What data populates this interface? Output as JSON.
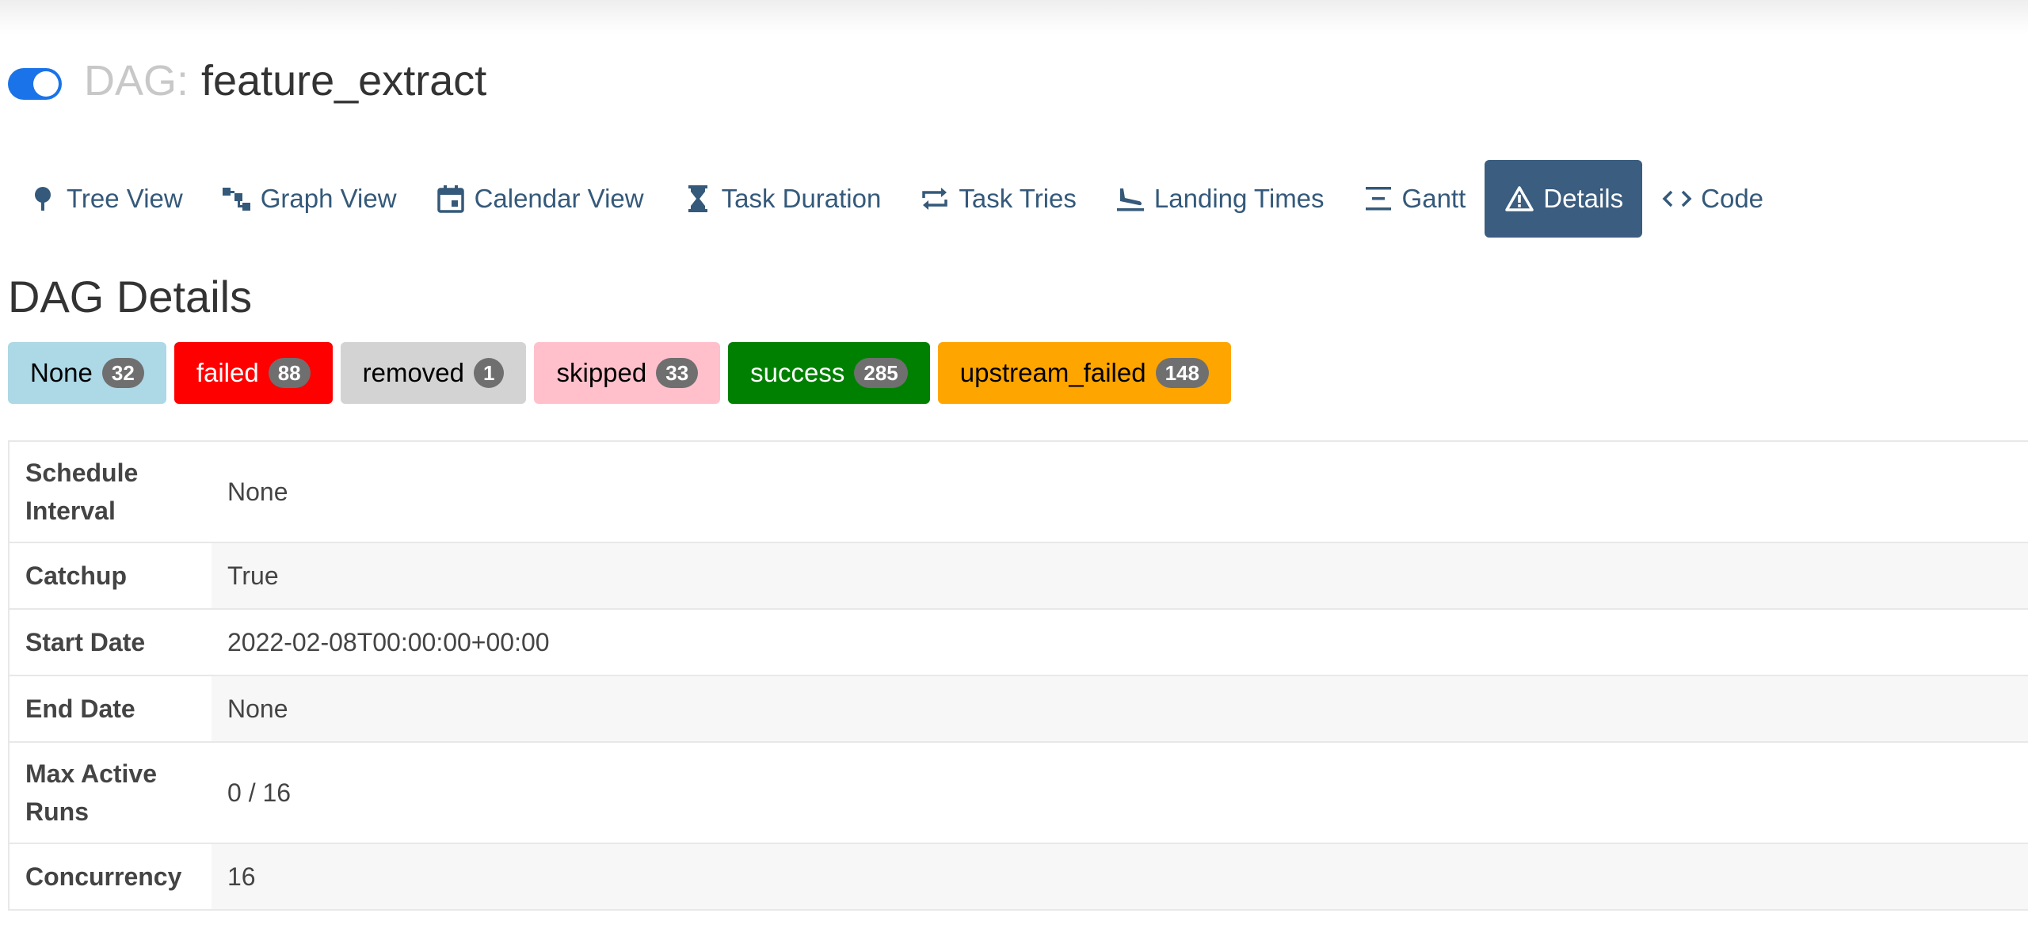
{
  "header": {
    "dag_prefix": "DAG:",
    "dag_id": "feature_extract",
    "toggle_on": true
  },
  "tabs": [
    {
      "label": "Tree View",
      "icon": "tree-icon"
    },
    {
      "label": "Graph View",
      "icon": "graph-icon"
    },
    {
      "label": "Calendar View",
      "icon": "calendar-icon"
    },
    {
      "label": "Task Duration",
      "icon": "hourglass-icon"
    },
    {
      "label": "Task Tries",
      "icon": "repeat-icon"
    },
    {
      "label": "Landing Times",
      "icon": "plane-landing-icon"
    },
    {
      "label": "Gantt",
      "icon": "gantt-icon"
    },
    {
      "label": "Details",
      "icon": "warning-icon",
      "active": true
    },
    {
      "label": "Code",
      "icon": "code-icon"
    }
  ],
  "page": {
    "title": "DAG Details"
  },
  "states": [
    {
      "label": "None",
      "count": "32",
      "bg": "#add8e6",
      "fg": "#000000"
    },
    {
      "label": "failed",
      "count": "88",
      "bg": "#ff0000",
      "fg": "#ffffff"
    },
    {
      "label": "removed",
      "count": "1",
      "bg": "#d3d3d3",
      "fg": "#000000"
    },
    {
      "label": "skipped",
      "count": "33",
      "bg": "#ffc0cb",
      "fg": "#000000"
    },
    {
      "label": "success",
      "count": "285",
      "bg": "#008000",
      "fg": "#ffffff"
    },
    {
      "label": "upstream_failed",
      "count": "148",
      "bg": "#ffa500",
      "fg": "#000000"
    }
  ],
  "details": [
    {
      "key": "Schedule Interval",
      "value": "None"
    },
    {
      "key": "Catchup",
      "value": "True"
    },
    {
      "key": "Start Date",
      "value": "2022-02-08T00:00:00+00:00"
    },
    {
      "key": "End Date",
      "value": "None"
    },
    {
      "key": "Max Active Runs",
      "value": "0 / 16"
    },
    {
      "key": "Concurrency",
      "value": "16"
    }
  ]
}
